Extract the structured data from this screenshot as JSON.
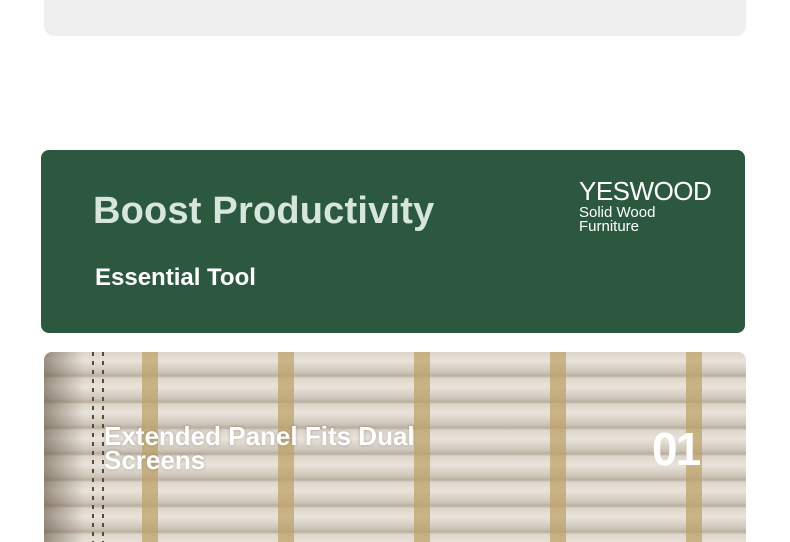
{
  "banner": {
    "headline": "Boost Productivity",
    "subline": "Essential Tool",
    "brand_name": "YESWOOD",
    "brand_tagline_line1": "Solid Wood",
    "brand_tagline_line2": "Furniture",
    "background_color": "#2c5840"
  },
  "feature": {
    "title": "Extended Panel Fits Dual Screens",
    "number": "01"
  }
}
